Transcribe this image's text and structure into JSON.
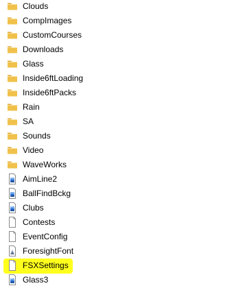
{
  "colors": {
    "folder_body": "#f0c14b",
    "folder_back": "#dca838",
    "highlight": "#ffff1e",
    "file_outline": "#8a8a8a"
  },
  "items": [
    {
      "label": "Clouds",
      "icon": "folder-icon"
    },
    {
      "label": "CompImages",
      "icon": "folder-icon"
    },
    {
      "label": "CustomCourses",
      "icon": "folder-icon"
    },
    {
      "label": "Downloads",
      "icon": "folder-icon"
    },
    {
      "label": "Glass",
      "icon": "folder-icon"
    },
    {
      "label": "Inside6ftLoading",
      "icon": "folder-icon"
    },
    {
      "label": "Inside6ftPacks",
      "icon": "folder-icon"
    },
    {
      "label": "Rain",
      "icon": "folder-icon"
    },
    {
      "label": "SA",
      "icon": "folder-icon"
    },
    {
      "label": "Sounds",
      "icon": "folder-icon"
    },
    {
      "label": "Video",
      "icon": "folder-icon"
    },
    {
      "label": "WaveWorks",
      "icon": "folder-icon"
    },
    {
      "label": "AimLine2",
      "icon": "image-file-icon"
    },
    {
      "label": "BallFindBckg",
      "icon": "image-file-icon"
    },
    {
      "label": "Clubs",
      "icon": "image-file-icon"
    },
    {
      "label": "Contests",
      "icon": "blank-file-icon"
    },
    {
      "label": "EventConfig",
      "icon": "blank-file-icon"
    },
    {
      "label": "ForesightFont",
      "icon": "font-file-icon"
    },
    {
      "label": "FSXSettings",
      "icon": "blank-file-icon",
      "highlighted": true
    },
    {
      "label": "Glass3",
      "icon": "image-file-icon"
    }
  ]
}
